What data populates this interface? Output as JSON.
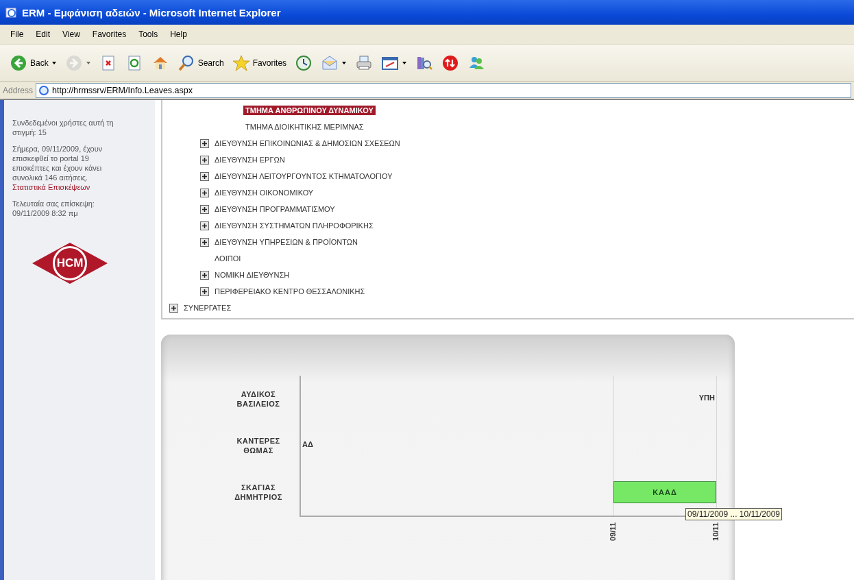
{
  "window": {
    "title": "ERM - Εμφάνιση αδειών - Microsoft Internet Explorer"
  },
  "menu": [
    "File",
    "Edit",
    "View",
    "Favorites",
    "Tools",
    "Help"
  ],
  "toolbar": [
    {
      "label": "Back",
      "dropdown": true,
      "disabled": false
    },
    {
      "dropdown": true,
      "disabled": true
    },
    {
      "dropdown": false,
      "disabled": false
    },
    {
      "dropdown": false,
      "disabled": false
    },
    {
      "dropdown": false,
      "disabled": false
    },
    {
      "label": "Search",
      "dropdown": false,
      "disabled": false
    },
    {
      "label": "Favorites",
      "dropdown": false,
      "disabled": false
    },
    {
      "dropdown": false,
      "disabled": false
    },
    {
      "dropdown": true,
      "disabled": false
    },
    {
      "dropdown": false,
      "disabled": false
    },
    {
      "dropdown": true,
      "disabled": false
    },
    {
      "dropdown": false,
      "disabled": false
    },
    {
      "dropdown": false,
      "disabled": false
    },
    {
      "dropdown": false,
      "disabled": false
    }
  ],
  "address": {
    "label": "Address",
    "value": "http://hrmssrv/ERM/Info.Leaves.aspx"
  },
  "sidebar": {
    "online": "Συνδεδεμένοι χρήστες αυτή τη στιγμή: 15",
    "today": "Σήμερα, 09/11/2009, έχουν επισκεφθεί το portal 19 επισκέπτες και έχουν κάνει συνολικά 146 αιτήσεις.",
    "stats_link": "Στατιστικά Επισκέψεων",
    "last_visit": "Τελευταία σας επίσκεψη: 09/11/2009 8:32 πμ",
    "logo": "HCM"
  },
  "tree": [
    {
      "children": [
        {
          "children": [
            {
              "label": "ΤΜΗΜΑ ΑΝΘΡΩΠΙΝΟΥ ΔΥΝΑΜΙΚΟΥ",
              "expandable": false,
              "selected": true
            },
            {
              "label": "ΤΜΗΜΑ ΔΙΟΙΚΗΤΙΚΗΣ ΜΕΡΙΜΝΑΣ",
              "expandable": false,
              "selected": false
            }
          ]
        },
        {
          "label": "ΔΙΕΥΘΥΝΣΗ ΕΠΙΚΟΙΝΩΝΙΑΣ & ΔΗΜΟΣΙΩΝ ΣΧΕΣΕΩΝ",
          "expandable": true,
          "selected": false
        },
        {
          "label": "ΔΙΕΥΘΥΝΣΗ ΕΡΓΩΝ",
          "expandable": true,
          "selected": false
        },
        {
          "label": "ΔΙΕΥΘΥΝΣΗ ΛΕΙΤΟΥΡΓΟΥΝΤΟΣ ΚΤΗΜΑΤΟΛΟΓΙΟΥ",
          "expandable": true,
          "selected": false
        },
        {
          "label": "ΔΙΕΥΘΥΝΣΗ ΟΙΚΟΝΟΜΙΚΟΥ",
          "expandable": true,
          "selected": false
        },
        {
          "label": "ΔΙΕΥΘΥΝΣΗ ΠΡΟΓΡΑΜΜΑΤΙΣΜΟΥ",
          "expandable": true,
          "selected": false
        },
        {
          "label": "ΔΙΕΥΘΥΝΣΗ ΣΥΣΤΗΜΑΤΩΝ ΠΛΗΡΟΦΟΡΙΚΗΣ",
          "expandable": true,
          "selected": false
        },
        {
          "label": "ΔΙΕΥΘΥΝΣΗ ΥΠΗΡΕΣΙΩΝ & ΠΡΟΪΟΝΤΩΝ",
          "expandable": true,
          "selected": false
        },
        {
          "label": "ΛΟΙΠΟΙ",
          "expandable": false,
          "selected": false
        },
        {
          "label": "ΝΟΜΙΚΗ ΔΙΕΥΘΥΝΣΗ",
          "expandable": true,
          "selected": false
        },
        {
          "label": "ΠΕΡΙΦΕΡΕΙΑΚΟ ΚΕΝΤΡΟ ΘΕΣΣΑΛΟΝΙΚΗΣ",
          "expandable": true,
          "selected": false
        }
      ]
    },
    {
      "label": "ΣΥΝΕΡΓΑΤΕΣ",
      "expandable": true,
      "selected": false
    }
  ],
  "gantt": {
    "ticks": [
      "09/11",
      "10/11"
    ],
    "rows": [
      {
        "name": "ΑΥΔΙΚΟΣ ΒΑΣΙΛΕΙΟΣ",
        "entries": [
          {
            "kind": "end-label",
            "label": "ΥΠΗ"
          }
        ]
      },
      {
        "name": "ΚΑΝΤΕΡΕΣ ΘΩΜΑΣ",
        "entries": [
          {
            "kind": "start-label",
            "label": "ΑΔ"
          }
        ]
      },
      {
        "name": "ΣΚΑΓΙΑΣ ΔΗΜΗΤΡΙΟΣ",
        "entries": [
          {
            "kind": "bar",
            "label": "ΚΑΑΔ",
            "tooltip": "09/11/2009 ... 10/11/2009"
          }
        ]
      }
    ]
  }
}
